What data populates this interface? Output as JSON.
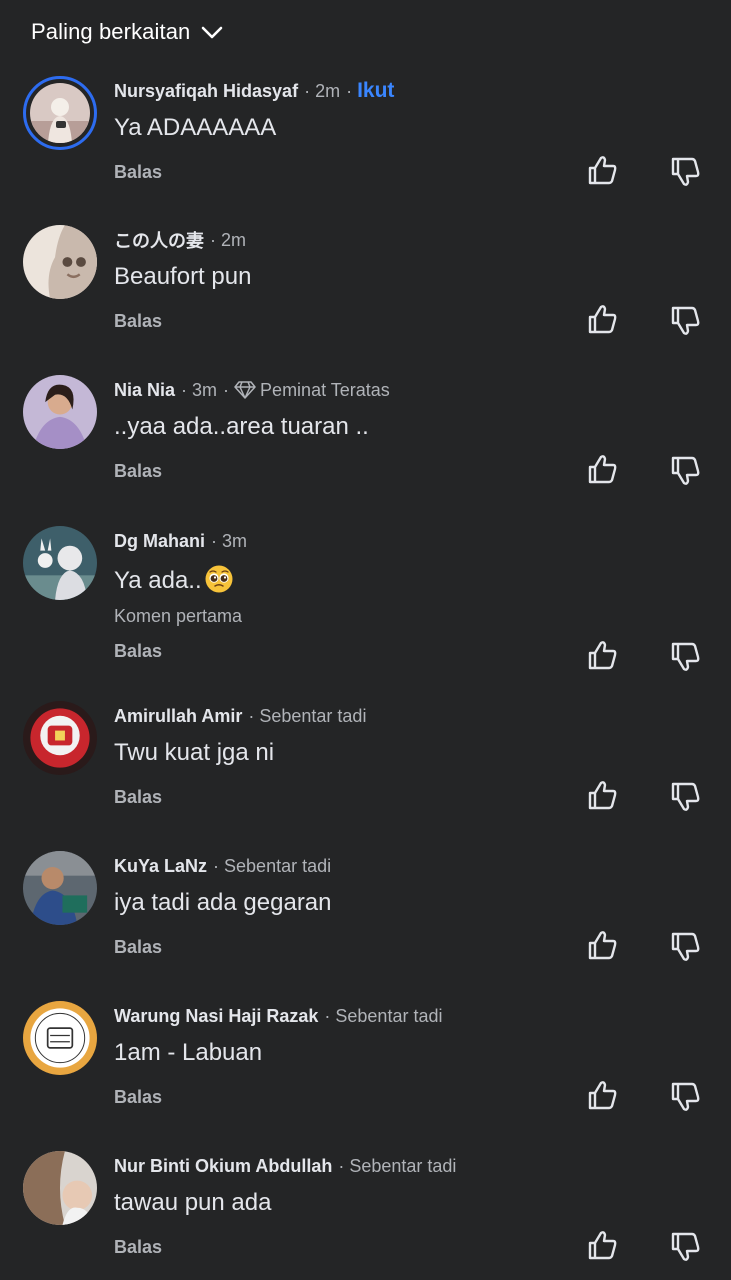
{
  "header": {
    "sort_label": "Paling berkaitan",
    "sort_icon": "chevron-down-icon"
  },
  "comments": [
    {
      "author": "Nursyafiqah Hidasyaf",
      "time": "2m",
      "follow": "Ikut",
      "text": "Ya ADAAAAAA",
      "reply": "Balas"
    },
    {
      "author": "この人の妻",
      "time": "2m",
      "text": "Beaufort pun",
      "reply": "Balas"
    },
    {
      "author": "Nia Nia",
      "time": "3m",
      "badge": "Peminat Teratas",
      "badge_icon": "diamond-icon",
      "text": "..yaa ada..area tuaran ..",
      "reply": "Balas"
    },
    {
      "author": "Dg Mahani",
      "time": "3m",
      "text": "Ya ada..",
      "emoji": "pleading-face-emoji",
      "sub": "Komen pertama",
      "reply": "Balas"
    },
    {
      "author": "Amirullah Amir",
      "time": "Sebentar tadi",
      "text": "Twu kuat jga ni",
      "reply": "Balas"
    },
    {
      "author": "KuYa LaNz",
      "time": "Sebentar tadi",
      "text": "iya tadi ada gegaran",
      "reply": "Balas"
    },
    {
      "author": "Warung Nasi Haji Razak",
      "time": "Sebentar tadi",
      "text": "1am - Labuan",
      "reply": "Balas"
    },
    {
      "author": "Nur Binti Okium Abdullah",
      "time": "Sebentar tadi",
      "text": "tawau pun ada",
      "reply": "Balas"
    }
  ],
  "colors": {
    "background": "#242526",
    "text": "#e4e6eb",
    "muted": "#b0b3b8",
    "accent": "#3a86ff"
  }
}
